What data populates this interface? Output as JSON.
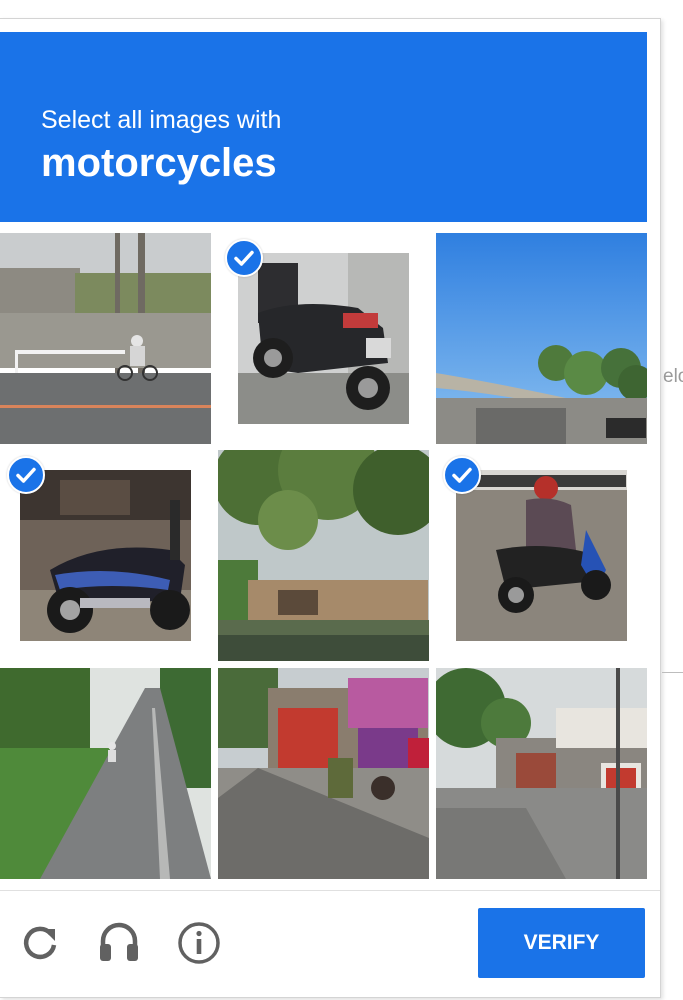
{
  "header": {
    "instruction": "Select all images with",
    "target": "motorcycles",
    "color": "#1a73e8"
  },
  "tiles": [
    {
      "id": 1,
      "scene": "street with rider on bicycle",
      "selected": false
    },
    {
      "id": 2,
      "scene": "parked scooter close-up",
      "selected": true
    },
    {
      "id": 3,
      "scene": "overpass under blue sky",
      "selected": false
    },
    {
      "id": 4,
      "scene": "parked motorcycle",
      "selected": true
    },
    {
      "id": 5,
      "scene": "tree over river",
      "selected": false
    },
    {
      "id": 6,
      "scene": "rider on scooter with helmet",
      "selected": true
    },
    {
      "id": 7,
      "scene": "rural road through greenery",
      "selected": false
    },
    {
      "id": 8,
      "scene": "roadside shops",
      "selected": false
    },
    {
      "id": 9,
      "scene": "road with shop and sign",
      "selected": false
    }
  ],
  "controls": {
    "reload_icon": "reload-icon",
    "audio_icon": "headphones-icon",
    "info_icon": "info-icon",
    "verify_label": "VERIFY"
  },
  "background": {
    "partial_text": "elo"
  }
}
